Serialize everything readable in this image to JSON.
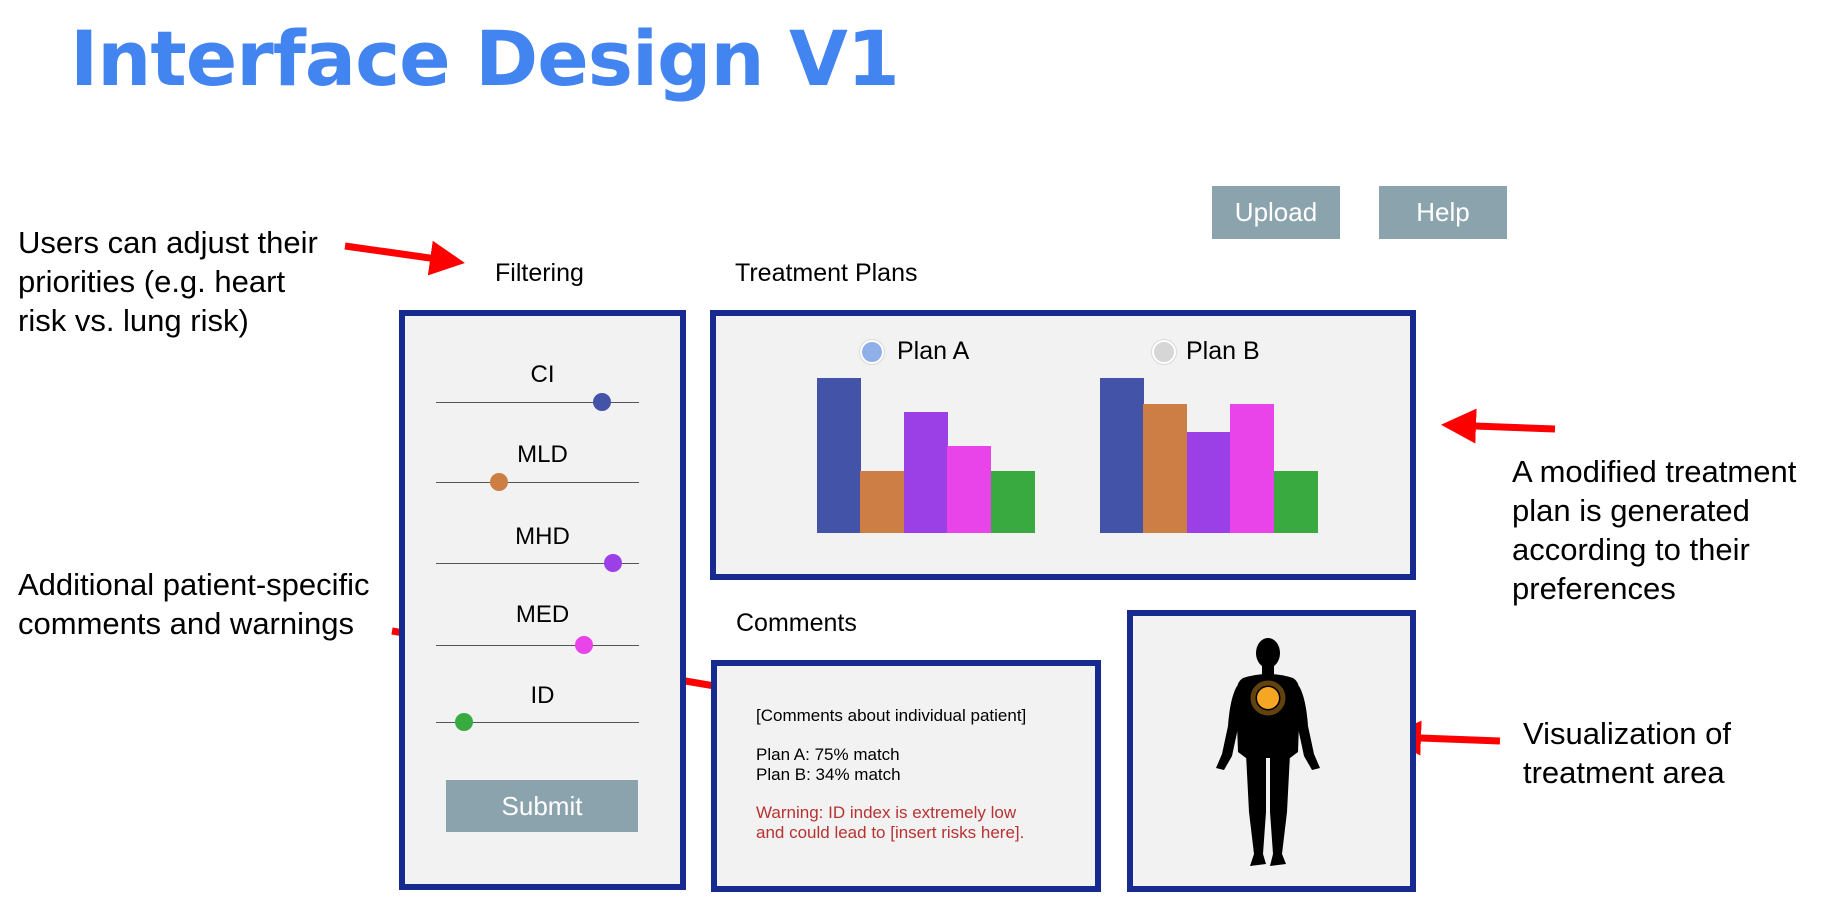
{
  "title": "Interface Design V1",
  "annotations": {
    "filtering": "Users can adjust their\npriorities (e.g. heart\nrisk vs. lung risk)",
    "comments": "Additional patient-specific\ncomments and warnings",
    "plan": "A modified treatment\nplan is generated\naccording to their\npreferences",
    "visualization": "Visualization of\ntreatment area"
  },
  "toolbar": {
    "upload_label": "Upload",
    "help_label": "Help"
  },
  "filtering": {
    "label": "Filtering",
    "sliders": [
      {
        "label": "CI",
        "value": 0.82,
        "color": "#4353a8"
      },
      {
        "label": "MLD",
        "value": 0.31,
        "color": "#cd7e44"
      },
      {
        "label": "MHD",
        "value": 0.87,
        "color": "#9a40e6"
      },
      {
        "label": "MED",
        "value": 0.73,
        "color": "#e943ea"
      },
      {
        "label": "ID",
        "value": 0.14,
        "color": "#38aa3f"
      }
    ],
    "submit_label": "Submit"
  },
  "treatment_plans": {
    "label": "Treatment Plans",
    "series_colors": [
      "#4353a8",
      "#cd7e44",
      "#9a40e6",
      "#e943ea",
      "#38aa3f"
    ],
    "plans": [
      {
        "label": "Plan A",
        "selected": true,
        "radio_color": "#8fb0e8",
        "values": [
          1.0,
          0.4,
          0.78,
          0.56,
          0.4
        ]
      },
      {
        "label": "Plan B",
        "selected": false,
        "radio_color": "#d6d6d6",
        "values": [
          1.0,
          0.83,
          0.65,
          0.83,
          0.4
        ]
      }
    ]
  },
  "comments": {
    "label": "Comments",
    "header": "[Comments about individual patient]",
    "plan_a": "Plan A: 75% match",
    "plan_b": "Plan B: 34% match",
    "warning_line1": "Warning: ID index is extremely low",
    "warning_line2": "and could lead to [insert risks here].",
    "warning_color": "#b83232"
  },
  "visualization": {
    "highlight_color": "#f5a623"
  },
  "colors": {
    "title": "#4284f0",
    "panel_border": "#172a8f",
    "button": "#8ba3ad",
    "arrow": "#ff0000"
  }
}
